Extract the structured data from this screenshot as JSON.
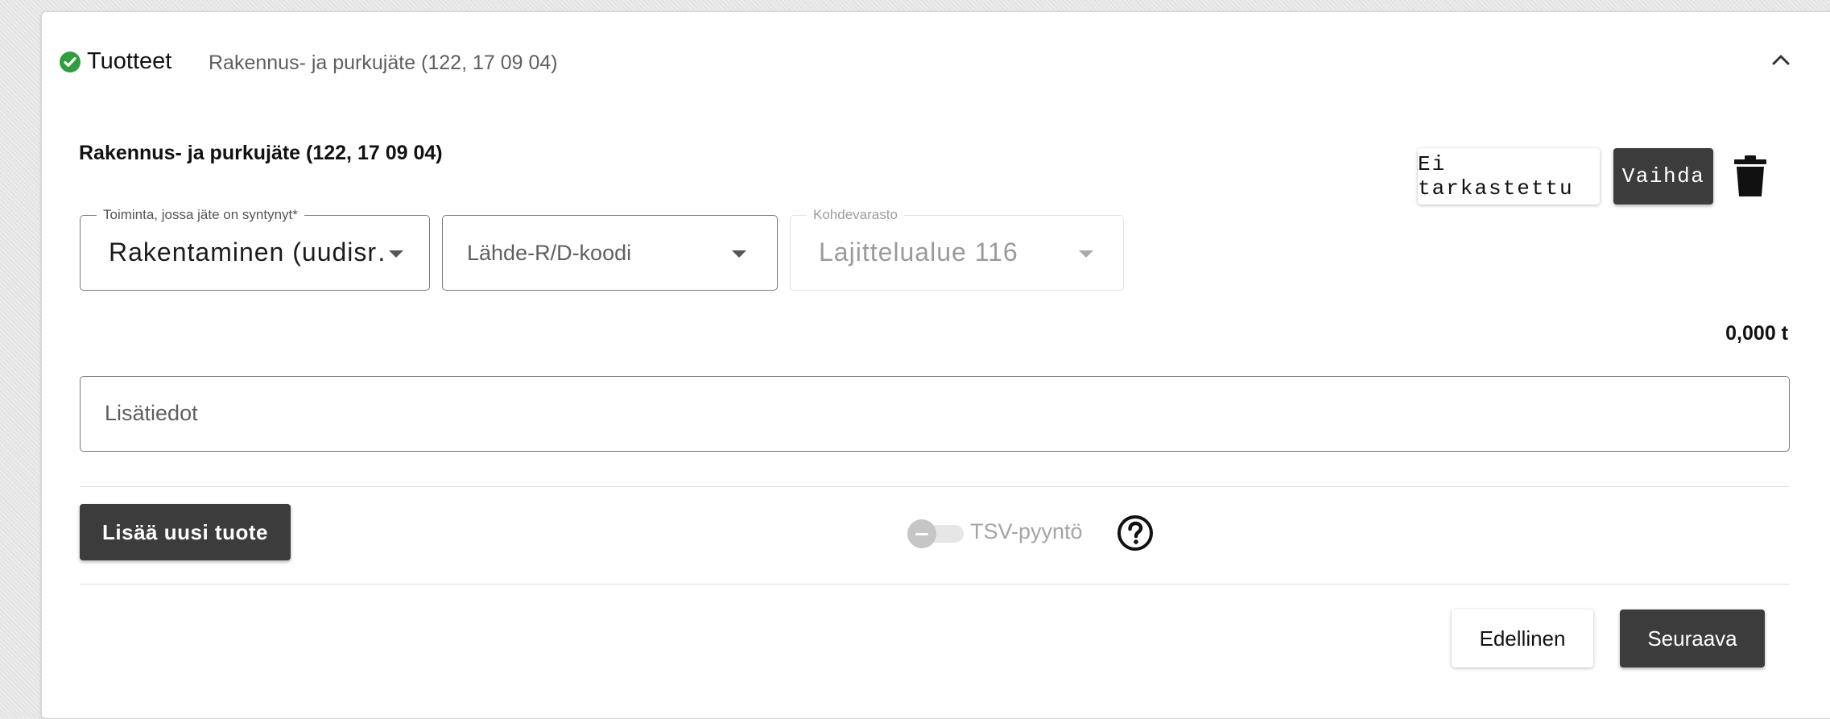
{
  "header": {
    "title": "Tuotteet",
    "subtitle": "Rakennus- ja purkujäte (122, 17 09 04)",
    "status_icon": "check-circle-icon",
    "status_color": "#2e9e3e",
    "collapse_icon": "chevron-up-icon"
  },
  "product": {
    "title": "Rakennus- ja purkujäte (122, 17 09 04)",
    "inspection_button": "Ei tarkastettu",
    "change_button": "Vaihda",
    "delete_icon": "trash-icon",
    "fields": {
      "activity": {
        "label": "Toiminta, jossa jäte on syntynyt*",
        "value": "Rakentaminen (uudisr…"
      },
      "source_code": {
        "placeholder": "Lähde-R/D-koodi"
      },
      "target_storage": {
        "label": "Kohdevarasto",
        "value": "Lajittelualue 116"
      }
    },
    "total": "0,000 t",
    "notes": {
      "placeholder": "Lisätiedot"
    }
  },
  "actions": {
    "add_product": "Lisää uusi tuote",
    "tsv_label": "TSV-pyyntö",
    "tsv_enabled": false,
    "help_icon": "question-circle-icon",
    "previous": "Edellinen",
    "next": "Seuraava"
  },
  "colors": {
    "dark_button": "#3c3c3c",
    "success": "#2e9e3e"
  }
}
